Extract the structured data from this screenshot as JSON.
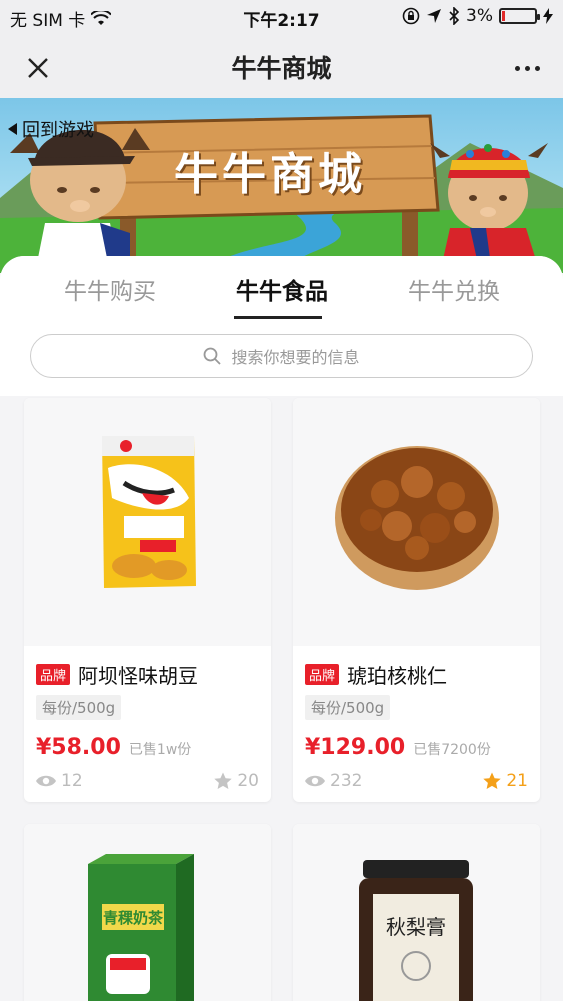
{
  "status_bar": {
    "carrier": "无 SIM 卡",
    "time": "下午2:17",
    "battery": "3%",
    "battery_level": 0.03,
    "battery_color": "#e02a2a"
  },
  "nav": {
    "title": "牛牛商城",
    "close_icon": "close-icon",
    "more_icon": "more-dots-icon"
  },
  "banner": {
    "back_label": "回到游戏",
    "title": "牛牛商城"
  },
  "tabs": [
    {
      "label": "牛牛购买",
      "active": false
    },
    {
      "label": "牛牛食品",
      "active": true
    },
    {
      "label": "牛牛兑换",
      "active": false
    }
  ],
  "search": {
    "placeholder": "搜索你想要的信息"
  },
  "products": [
    {
      "brand": "品牌",
      "name": "阿坝怪味胡豆",
      "spec": "每份/500g",
      "price": "¥58.00",
      "sold": "已售1w份",
      "views": "12",
      "favorites": "20",
      "favorited": false,
      "image": "snack-bag"
    },
    {
      "brand": "品牌",
      "name": "琥珀核桃仁",
      "spec": "每份/500g",
      "price": "¥129.00",
      "sold": "已售7200份",
      "views": "232",
      "favorites": "21",
      "favorited": true,
      "image": "walnut-bowl"
    },
    {
      "name": "青稞奶茶",
      "image": "tea-box"
    },
    {
      "name": "秋梨膏",
      "image": "jar"
    }
  ],
  "colors": {
    "accent": "#e8202a",
    "fav": "#f4a019"
  }
}
